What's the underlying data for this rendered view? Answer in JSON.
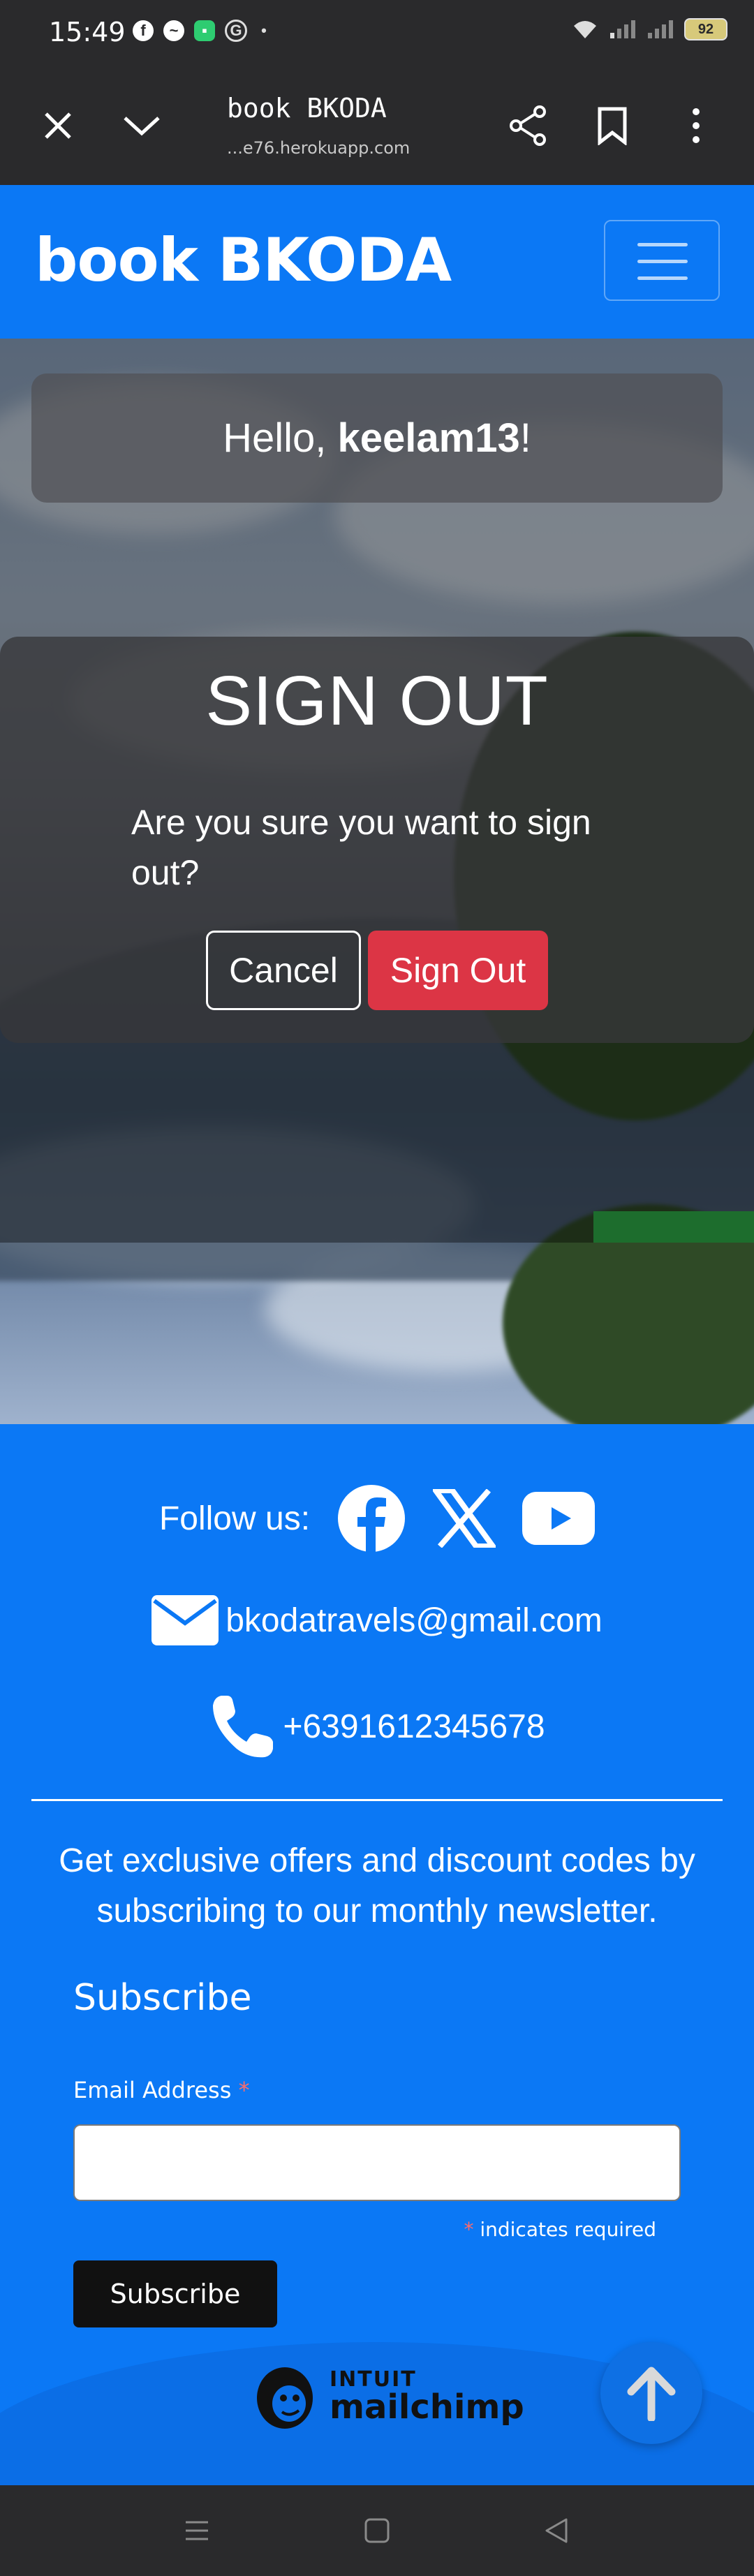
{
  "status_bar": {
    "time": "15:49",
    "battery": "92"
  },
  "browser": {
    "title": "book BKODA",
    "url": "...e76.herokuapp.com"
  },
  "navbar": {
    "brand": "book BKODA"
  },
  "greeting": {
    "prefix": "Hello, ",
    "username": "keelam13",
    "suffix": "!"
  },
  "signout": {
    "title": "SIGN OUT",
    "message": "Are you sure you want to sign out?",
    "cancel_label": "Cancel",
    "confirm_label": "Sign Out"
  },
  "footer": {
    "follow_label": "Follow us:",
    "email": "bkodatravels@gmail.com",
    "phone": "+6391612345678",
    "newsletter_text": "Get exclusive offers and discount codes by subscribing to our monthly newsletter.",
    "form": {
      "title": "Subscribe",
      "email_label": "Email Address",
      "required_marker": "*",
      "email_value": "",
      "required_note": "indicates required",
      "subscribe_label": "Subscribe"
    },
    "mailchimp": {
      "line1": "INTUIT",
      "line2": "mailchimp"
    }
  },
  "colors": {
    "primary": "#0b78f5",
    "danger": "#dc3545",
    "dark": "#2a2a2c"
  }
}
